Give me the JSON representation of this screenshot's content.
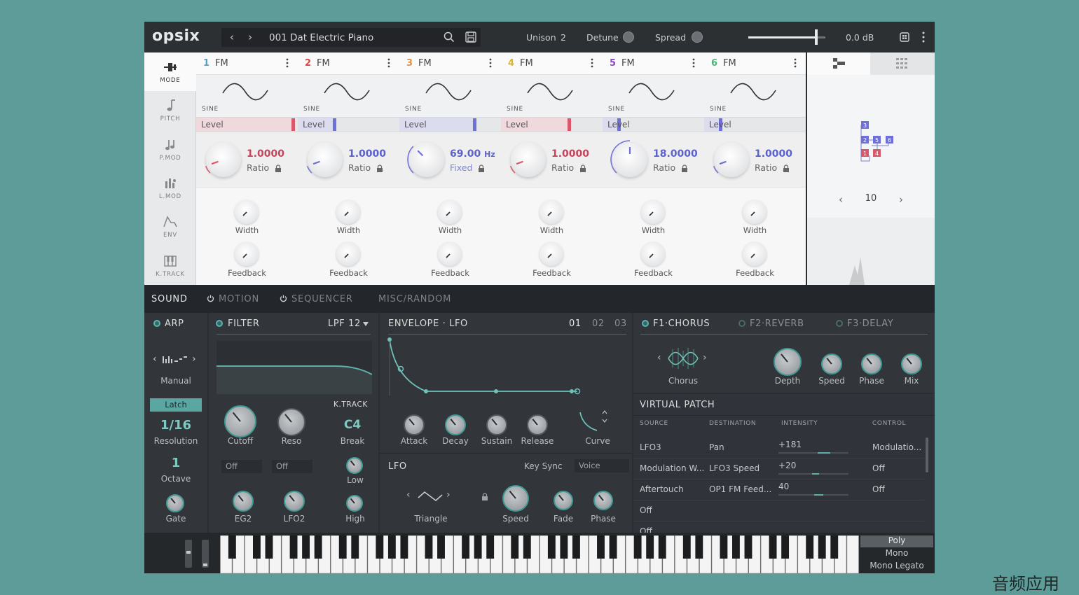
{
  "app": {
    "logo": "opsix"
  },
  "topbar": {
    "prev_icon": "chevron-left-icon",
    "next_icon": "chevron-right-icon",
    "preset": "001 Dat Electric Piano",
    "unison_label": "Unison",
    "unison_value": "2",
    "detune_label": "Detune",
    "spread_label": "Spread",
    "volume": "0.0 dB",
    "volume_fraction": 0.88
  },
  "sidebar": {
    "items": [
      {
        "label": "MODE",
        "icon": "mode-icon",
        "active": true
      },
      {
        "label": "PITCH",
        "icon": "note-icon"
      },
      {
        "label": "P.MOD",
        "icon": "double-note-icon"
      },
      {
        "label": "L.MOD",
        "icon": "level-mod-icon"
      },
      {
        "label": "ENV",
        "icon": "envelope-icon"
      },
      {
        "label": "K.TRACK",
        "icon": "keyboard-icon"
      }
    ]
  },
  "operators": [
    {
      "num": "1",
      "type": "FM",
      "wave": "SINE",
      "level_label": "Level",
      "value": "1.0000",
      "unit": "",
      "mode": "Ratio",
      "width": "Width",
      "feedback": "Feedback",
      "color": "#4fa3c7",
      "level_color": "#d9566b",
      "level_fraction": 0.97,
      "val_color": "#c2475c"
    },
    {
      "num": "2",
      "type": "FM",
      "wave": "SINE",
      "level_label": "Level",
      "value": "1.0000",
      "unit": "",
      "mode": "Ratio",
      "width": "Width",
      "feedback": "Feedback",
      "color": "#d8474a",
      "level_color": "#6f6fd8",
      "level_fraction": 0.36,
      "val_color": "#5b62c9"
    },
    {
      "num": "3",
      "type": "FM",
      "wave": "SINE",
      "level_label": "Level",
      "value": "69.00",
      "unit": "Hz",
      "mode": "Fixed",
      "width": "Width",
      "feedback": "Feedback",
      "color": "#e6913a",
      "level_color": "#6f6fd8",
      "level_fraction": 0.75,
      "val_color": "#5b62c9"
    },
    {
      "num": "4",
      "type": "FM",
      "wave": "SINE",
      "level_label": "Level",
      "value": "1.0000",
      "unit": "",
      "mode": "Ratio",
      "width": "Width",
      "feedback": "Feedback",
      "color": "#d9b531",
      "level_color": "#d9566b",
      "level_fraction": 0.68,
      "val_color": "#c2475c"
    },
    {
      "num": "5",
      "type": "FM",
      "wave": "SINE",
      "level_label": "Level",
      "value": "18.0000",
      "unit": "",
      "mode": "Ratio",
      "width": "Width",
      "feedback": "Feedback",
      "color": "#8e47c7",
      "level_color": "#6f6fd8",
      "level_fraction": 0.15,
      "val_color": "#5b62c9"
    },
    {
      "num": "6",
      "type": "FM",
      "wave": "SINE",
      "level_label": "Level",
      "value": "1.0000",
      "unit": "",
      "mode": "Ratio",
      "width": "Width",
      "feedback": "Feedback",
      "color": "#4fb27a",
      "level_color": "#6f6fd8",
      "level_fraction": 0.15,
      "val_color": "#5b62c9"
    }
  ],
  "algorithm": {
    "number": "10",
    "tab1_icon": "algorithm-icon",
    "tab2_icon": "grid-icon",
    "ops": [
      "3",
      "2",
      "5",
      "6",
      "1",
      "4"
    ]
  },
  "section_tabs": [
    "SOUND",
    "MOTION",
    "SEQUENCER",
    "MISC/RANDOM"
  ],
  "arp": {
    "title": "ARP",
    "pattern": "Manual",
    "latch": "Latch",
    "resolution": "1/16",
    "resolution_label": "Resolution",
    "octave": "1",
    "octave_label": "Octave",
    "gate": "Gate"
  },
  "filter": {
    "title": "FILTER",
    "type": "LPF 12",
    "cutoff": "Cutoff",
    "reso": "Reso",
    "ktrack": "K.TRACK",
    "break_value": "C4",
    "break_label": "Break",
    "low": "Low",
    "high": "High",
    "src1": "Off",
    "src2": "Off",
    "eg2": "EG2",
    "lfo2": "LFO2"
  },
  "envelope": {
    "title": "ENVELOPE · LFO",
    "tabs": [
      "01",
      "02",
      "03"
    ],
    "attack": "Attack",
    "decay": "Decay",
    "sustain": "Sustain",
    "release": "Release",
    "curve": "Curve"
  },
  "lfo": {
    "title": "LFO",
    "keysync_label": "Key Sync",
    "keysync_value": "Voice",
    "wave": "Triangle",
    "speed": "Speed",
    "fade": "Fade",
    "phase": "Phase"
  },
  "effects": {
    "slots": [
      "F1·CHORUS",
      "F2·REVERB",
      "F3·DELAY"
    ],
    "type": "Chorus",
    "depth": "Depth",
    "speed": "Speed",
    "phase": "Phase",
    "mix": "Mix"
  },
  "virtual_patch": {
    "title": "VIRTUAL PATCH",
    "columns": [
      "SOURCE",
      "DESTINATION",
      "INTENSITY",
      "CONTROL"
    ],
    "rows": [
      {
        "source": "LFO3",
        "destination": "Pan",
        "intensity": "+181",
        "control": "Modulatio...",
        "fraction": 0.6
      },
      {
        "source": "Modulation W...",
        "destination": "LFO3 Speed",
        "intensity": "+20",
        "control": "Off",
        "fraction": 0.52
      },
      {
        "source": "Aftertouch",
        "destination": "OP1 FM Feed...",
        "intensity": "40",
        "control": "Off",
        "fraction": 0.55
      },
      {
        "source": "Off",
        "destination": "",
        "intensity": "",
        "control": "",
        "fraction": 0
      },
      {
        "source": "Off",
        "destination": "",
        "intensity": "",
        "control": "",
        "fraction": 0
      }
    ]
  },
  "voice_mode": {
    "options": [
      "Poly",
      "Mono",
      "Mono Legato"
    ],
    "selected": "Poly"
  },
  "watermark": "音频应用"
}
